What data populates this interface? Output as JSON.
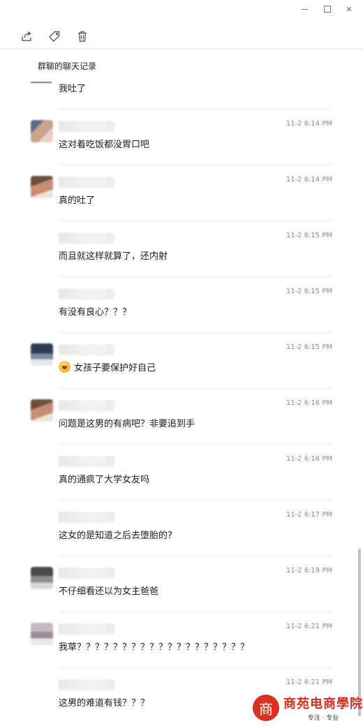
{
  "window": {
    "controls": [
      "minimize",
      "maximize",
      "close"
    ]
  },
  "toolbar": {
    "icons": [
      "share-icon",
      "tag-icon",
      "trash-icon"
    ]
  },
  "chat": {
    "title": "群聊的聊天记录"
  },
  "messages": [
    {
      "time": "",
      "text": "我吐了",
      "avatar": "none",
      "divider": false
    },
    {
      "time": "11-2 6:14 PM",
      "text": "这对着吃饭都没胃口吧",
      "avatar": "av-a",
      "divider": true
    },
    {
      "time": "11-2 6:14 PM",
      "text": "真的吐了",
      "avatar": "av-b",
      "divider": true
    },
    {
      "time": "11-2 6:15 PM",
      "text": "而且就这样就算了，还内射",
      "avatar": "none",
      "divider": true
    },
    {
      "time": "11-2 6:15 PM",
      "text": "有没有良心？？？",
      "avatar": "none",
      "divider": true
    },
    {
      "time": "11-2 6:15 PM",
      "text": "女孩子要保护好自己",
      "avatar": "av-c",
      "divider": true,
      "emoji": true
    },
    {
      "time": "11-2 6:16 PM",
      "text": "问题是这男的有病吧？非要追到手",
      "avatar": "av-b",
      "divider": true
    },
    {
      "time": "11-2 6:16 PM",
      "text": "真的通疯了大学女友吗",
      "avatar": "none",
      "divider": true
    },
    {
      "time": "11-2 6:17 PM",
      "text": "这女的是知道之后去堕胎的?",
      "avatar": "none",
      "divider": true
    },
    {
      "time": "11-2 6:19 PM",
      "text": "不仔细看还以为女主爸爸",
      "avatar": "av-d",
      "divider": true
    },
    {
      "time": "11-2 6:21 PM",
      "text": "我草？？？？？？？？？？？？？？？？？？？",
      "avatar": "av-e",
      "divider": true
    },
    {
      "time": "11-2 6:21 PM",
      "text": "这男的难道有钱？？？",
      "avatar": "none",
      "divider": true
    }
  ],
  "watermark": {
    "name": "商苑电商學院",
    "sub": "专注 · 专业"
  }
}
